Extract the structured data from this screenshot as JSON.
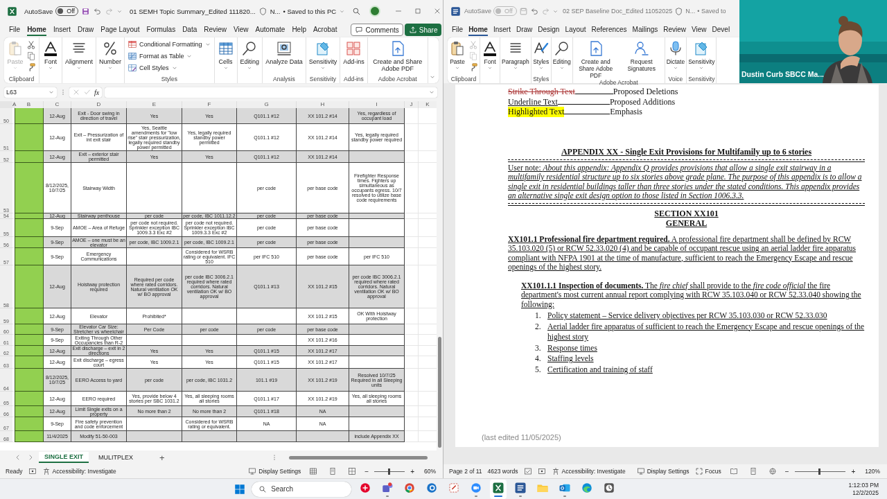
{
  "excel": {
    "title_bar": {
      "autosave_label": "AutoSave",
      "autosave_on": false,
      "toggle_text": "Off",
      "title": "01 SEMH Topic Summary_Edited 111820...",
      "sensitivity": "N...",
      "save_status": "• Saved to this PC"
    },
    "tabs": [
      {
        "label": "File",
        "selected": false
      },
      {
        "label": "Home",
        "selected": true
      },
      {
        "label": "Insert",
        "selected": false
      },
      {
        "label": "Draw",
        "selected": false
      },
      {
        "label": "Page Layout",
        "selected": false
      },
      {
        "label": "Formulas",
        "selected": false
      },
      {
        "label": "Data",
        "selected": false
      },
      {
        "label": "Review",
        "selected": false
      },
      {
        "label": "View",
        "selected": false
      },
      {
        "label": "Automate",
        "selected": false
      },
      {
        "label": "Help",
        "selected": false
      },
      {
        "label": "Acrobat",
        "selected": false
      }
    ],
    "comments": "Comments",
    "share": "Share",
    "ribbon": [
      {
        "label": "Clipboard",
        "items": [
          {
            "kind": "large",
            "label": "Paste",
            "disabled": true,
            "menu": true
          },
          {
            "kind": "small",
            "disabled": false
          },
          {
            "kind": "small",
            "disabled": false
          },
          {
            "kind": "small",
            "disabled": false
          }
        ]
      },
      {
        "items": [
          {
            "kind": "large",
            "label": "Font",
            "disabled": false,
            "menu": true
          }
        ]
      },
      {
        "items": [
          {
            "kind": "large",
            "label": "Alignment",
            "disabled": false,
            "menu": true
          }
        ]
      },
      {
        "items": [
          {
            "kind": "large",
            "label": "Number",
            "disabled": false,
            "menu": true
          }
        ]
      },
      {
        "label": "Styles",
        "items": [
          {
            "kind": "row",
            "label": "Conditional Formatting",
            "disabled": false,
            "menu": true
          },
          {
            "kind": "row",
            "label": "Format as Table",
            "disabled": false,
            "menu": true
          },
          {
            "kind": "row",
            "label": "Cell Styles",
            "disabled": false,
            "menu": true
          }
        ]
      },
      {
        "items": [
          {
            "kind": "large",
            "label": "Cells",
            "disabled": false,
            "menu": true
          }
        ]
      },
      {
        "items": [
          {
            "kind": "large",
            "label": "Editing",
            "disabled": false,
            "menu": true
          }
        ]
      },
      {
        "label": "Analysis",
        "items": [
          {
            "kind": "large",
            "label": "Analyze Data",
            "disabled": false,
            "menu": false
          }
        ]
      },
      {
        "label": "Sensitivity",
        "items": [
          {
            "kind": "large",
            "label": "Sensitivity",
            "disabled": false,
            "menu": true
          }
        ]
      },
      {
        "label": "Add-ins",
        "items": [
          {
            "kind": "large",
            "label": "Add-ins",
            "disabled": false,
            "menu": false
          }
        ]
      },
      {
        "label": "Adobe Acrobat",
        "items": [
          {
            "kind": "large",
            "label": "Create and Share Adobe PDF",
            "disabled": false,
            "menu": false
          }
        ]
      }
    ],
    "name_box": "L63",
    "function_button": "fx",
    "columns": [
      "A",
      "B",
      "C",
      "D",
      "E",
      "F",
      "G",
      "H",
      "I",
      "J",
      "K"
    ],
    "rows": [
      {
        "number": "50",
        "cells": {
          "C": "12-Aug",
          "D": "Exit - Door swing in direction of travel",
          "E": "Yes",
          "F": "Yes",
          "G": "Q101.1 #12",
          "H": "XX 101.2 #14",
          "I": "Yes, regardless of occupant load"
        }
      },
      {
        "number": "51",
        "cells": {
          "C": "12-Aug",
          "D": "Exit – Pressurization of int exit stair",
          "E": "Yes, Seattle amendments for \"low rise\" stair pressurization, legally required standby power permitted",
          "F": "Yes, legally required standby power permitted",
          "G": "Q101.1 #12",
          "H": "XX 101.2 #14",
          "I": "Yes, legally required standby power required"
        }
      },
      {
        "number": "52",
        "cells": {
          "C": "12-Aug",
          "D": "Exit – exterior stair permitted",
          "E": "Yes",
          "F": "Yes",
          "G": "Q101.1 #12",
          "H": "XX 101.2 #14"
        }
      },
      {
        "number": "53",
        "cells": {
          "C": "8/12/2025, 10/7/25",
          "D": "Stairway Width",
          "G": "per code",
          "H": "per base code",
          "I": "Firefighter Response times. Fighters up simultaneous as occupants egress. 10/7 resolved to utilize base code requirements"
        }
      },
      {
        "number": "54",
        "cells": {
          "C": "12-Aug",
          "D": "Stairway penthouse",
          "E": "per code",
          "F": "per code, IBC 1011.12.2",
          "G": "per code",
          "H": "per base code"
        }
      },
      {
        "number": "55",
        "cells": {
          "C": "9-Sep",
          "D": "AMOE – Area of Refuge",
          "E": "per code not required. Sprinkler exception IBC 1009.3.3 Exc #2",
          "F": "per code not required. Sprinkler exception IBC 1009.3.3 Exc #2",
          "G": "per code",
          "H": "per base code"
        }
      },
      {
        "number": "56",
        "cells": {
          "C": "9-Sep",
          "D": "AMOE – one must be an elevator",
          "E": "per code, IBC 1009.2.1",
          "F": "per code, IBC 1009.2.1",
          "G": "per code",
          "H": "per base code"
        }
      },
      {
        "number": "57",
        "cells": {
          "C": "9-Sep",
          "D": "Emergency Communications",
          "F": "Considered for WSRB rating or equivalent. IFC 510",
          "G": "per IFC 510",
          "H": "per base code",
          "I": "per IFC 510"
        }
      },
      {
        "number": "58",
        "cells": {
          "C": "12-Aug",
          "D": "Hoistway protection required",
          "E": "Required per code where rated corridors. Natural ventilation OK w/ BO approval",
          "F": "per code IBC 3006.2.1 required where rated corridors. Natural ventilation OK w/ BO approval",
          "G": "Q101.1 #13",
          "H": "XX 101.2 #15",
          "I": "per code IBC 3006.2.1 required where rated corridors. Natural ventilation OK w/ BO approval"
        }
      },
      {
        "number": "59",
        "cells": {
          "C": "12-Aug",
          "D": "Elevator",
          "E": "Prohibited*",
          "H": "XX 101.2 #15",
          "I": "OK With Hoistway protection"
        }
      },
      {
        "number": "60",
        "cells": {
          "C": "9-Sep",
          "D": "Elevator Car Size: Stretcher vs wheelchair",
          "E": "Per Code",
          "F": "per code",
          "G": "per code",
          "H": "per base code"
        }
      },
      {
        "number": "61",
        "cells": {
          "C": "9-Sep",
          "D": "Exiting Through Other Occupancies than R-2",
          "H": "XX 101.2 #16"
        }
      },
      {
        "number": "62",
        "cells": {
          "C": "12-Aug",
          "D": "Exit discharge – exit in 2 directions",
          "E": "Yes",
          "F": "Yes",
          "G": "Q101.1 #15",
          "H": "XX 101.2 #17"
        }
      },
      {
        "number": "63",
        "cells": {
          "C": "12-Aug",
          "D": "Exit discharge – egress court",
          "E": "Yes",
          "F": "Yes",
          "G": "Q101.1 #15",
          "H": "XX 101.2 #17"
        }
      },
      {
        "number": "64",
        "cells": {
          "C": "8/12/2025, 10/7/25",
          "D": "EERO Access to yard",
          "E": "per code",
          "F": "per code, IBC 1031.2",
          "G": "101.1 #19",
          "H": "XX 101.2 #19",
          "I": "Resolved 10/7/25 Required in all Sleeping units"
        }
      },
      {
        "number": "65",
        "cells": {
          "C": "12-Aug",
          "D": "EERO required",
          "E": "Yes, provide below 4 stories per SBC 1031.2",
          "F": "Yes, all sleeping rooms all stories",
          "G": "Q101.1 #17",
          "H": "XX 101.2 #19",
          "I": "Yes, all sleeping rooms all stories"
        }
      },
      {
        "number": "66",
        "cells": {
          "C": "12-Aug",
          "D": "Limit Single exits on a property",
          "E": "No more than 2",
          "F": "No more than 2",
          "G": "Q101.1 #18",
          "H": "NA"
        }
      },
      {
        "number": "67",
        "cells": {
          "C": "9-Sep",
          "D": "Fire safety prevention and code enforcement",
          "F": "Considered for WSRB rating or equivalent.",
          "G": "NA",
          "H": "NA"
        }
      },
      {
        "number": "68",
        "cells": {
          "C": "11/4/2025",
          "D": "Modify 51-50-003",
          "I": "include Appendix XX"
        }
      }
    ],
    "sheet_tabs": [
      {
        "label": "SINGLE EXIT",
        "selected": true
      },
      {
        "label": "MULITPLEX",
        "selected": false
      }
    ],
    "add_sheet": "+",
    "status_bar": {
      "mode": "Ready",
      "accessibility": "Accessibility: Investigate",
      "display_settings": "Display Settings",
      "zoom_out": "−",
      "zoom_in": "+",
      "zoom": "60%",
      "zoom_slider": {
        "level": 0.48
      }
    }
  },
  "word": {
    "title_bar": {
      "autosave_label": "AutoSave",
      "autosave_on": false,
      "toggle_text": "Off",
      "title": "02 SEP Baseline Doc_Edited 11052025",
      "sensitivity": "N...",
      "save_status": "• Saved to"
    },
    "tabs": [
      {
        "label": "File",
        "selected": false
      },
      {
        "label": "Home",
        "selected": true
      },
      {
        "label": "Insert",
        "selected": false
      },
      {
        "label": "Draw",
        "selected": false
      },
      {
        "label": "Design",
        "selected": false
      },
      {
        "label": "Layout",
        "selected": false
      },
      {
        "label": "References",
        "selected": false
      },
      {
        "label": "Mailings",
        "selected": false
      },
      {
        "label": "Review",
        "selected": false
      },
      {
        "label": "View",
        "selected": false
      },
      {
        "label": "Devel",
        "selected": false
      }
    ],
    "ribbon": [
      {
        "label": "Clipboard",
        "items": [
          {
            "kind": "large",
            "label": "Paste",
            "disabled": false,
            "menu": true
          },
          {
            "kind": "small",
            "disabled": true
          },
          {
            "kind": "small",
            "disabled": true
          },
          {
            "kind": "small",
            "disabled": false
          }
        ]
      },
      {
        "items": [
          {
            "kind": "large",
            "label": "Font",
            "disabled": false,
            "menu": true
          }
        ]
      },
      {
        "items": [
          {
            "kind": "large",
            "label": "Paragraph",
            "disabled": false,
            "menu": true
          }
        ]
      },
      {
        "label": "Styles",
        "items": [
          {
            "kind": "large",
            "label": "Styles",
            "disabled": false,
            "menu": true
          }
        ]
      },
      {
        "items": [
          {
            "kind": "large",
            "label": "Editing",
            "disabled": false,
            "menu": true
          }
        ]
      },
      {
        "label": "Adobe Acrobat",
        "items": [
          {
            "kind": "large",
            "label": "Create and Share Adobe PDF",
            "disabled": false,
            "menu": false
          },
          {
            "kind": "large",
            "label": "Request Signatures",
            "disabled": false,
            "menu": false
          }
        ]
      },
      {
        "label": "Voice",
        "items": [
          {
            "kind": "large",
            "label": "Dictate",
            "disabled": false,
            "menu": true
          }
        ]
      },
      {
        "label": "Sensitivity",
        "items": [
          {
            "kind": "large",
            "label": "Sensitivity",
            "disabled": false,
            "menu": true
          }
        ]
      }
    ],
    "document": {
      "legend": [
        {
          "kind": "strike",
          "sample": "Strike Through Text",
          "meaning": "Proposed Deletions"
        },
        {
          "kind": "underline",
          "sample": "Underline Text",
          "meaning": "Proposed Additions"
        },
        {
          "kind": "highlight",
          "sample": "Highlighted Text",
          "meaning": "Emphasis"
        }
      ],
      "appendix_title": "APPENDIX XX - Single Exit Provisions for Multifamily up to 6 stories",
      "user_note": "User note: *About this appendix: Appendix Q provides provisions that allow a single exit stairway in a multifamily residential structure up to six stories above grade plane.  The purpose of this appendix is to allow a single exit in residential buildings taller than three stories under the stated conditions. This appendix provides an alternative single exit design option to those listed in Section 1006.3.3.*",
      "section_heading": [
        "SECTION XX101",
        "GENERAL"
      ],
      "paragraphs": [
        {
          "kind": "section",
          "text": "**XX101.1 Professional fire department required.**  A professional fire department shall be defined by RCW 35.103.020 (5) or RCW 52.33.020 (4) and be capable of occupant rescue using  an aerial ladder fire apparatus compliant with NFPA 1901 at the time of manufacture, sufficient to reach the Emergency Escape and rescue openings of the highest story."
        },
        {
          "kind": "subsection",
          "text": "**XX101.1.1 Inspection of documents.** The *fire chief* shall provide to the *fire code official* the fire department's most current annual report complying with RCW 35.103.040 or RCW 52.33.040 showing the following:"
        }
      ],
      "list": [
        {
          "number": "1.",
          "text": "Policy statement – Service delivery objectives per RCW 35.103.030 or RCW 52.33.030"
        },
        {
          "number": "2.",
          "text": "Aerial ladder fire apparatus of sufficient to reach the Emergency Escape and rescue openings of the highest story"
        },
        {
          "number": "3.",
          "text": "Response times"
        },
        {
          "number": "4.",
          "text": "Staffing levels"
        },
        {
          "number": "5.",
          "text": "Certification and training of staff"
        }
      ],
      "footer_note": "(last edited 11/05/2025)"
    },
    "status_bar": {
      "page": "Page 2 of 11",
      "words": "4623 words",
      "accessibility": "Accessibility: Investigate",
      "display_settings": "Display Settings",
      "focus": "Focus",
      "zoom_out": "−",
      "zoom_in": "+",
      "zoom": "120%",
      "zoom_slider": {
        "level": 0.48
      }
    }
  },
  "video": {
    "participant_name": "Dustin Curb SBCC Ma..."
  },
  "taskbar": {
    "search": {
      "placeholder": "Search"
    },
    "apps": [
      {
        "running": false,
        "selected": false
      },
      {
        "running": true,
        "selected": false
      },
      {
        "running": false,
        "selected": false
      },
      {
        "running": false,
        "selected": false
      },
      {
        "running": false,
        "selected": false
      },
      {
        "running": true,
        "selected": false
      },
      {
        "running": true,
        "selected": true
      },
      {
        "running": true,
        "selected": false
      },
      {
        "running": false,
        "selected": false
      },
      {
        "running": true,
        "selected": false
      },
      {
        "running": false,
        "selected": false
      },
      {
        "running": false,
        "selected": false
      }
    ],
    "time": "1:12:03 PM",
    "date": "12/2/2025"
  }
}
